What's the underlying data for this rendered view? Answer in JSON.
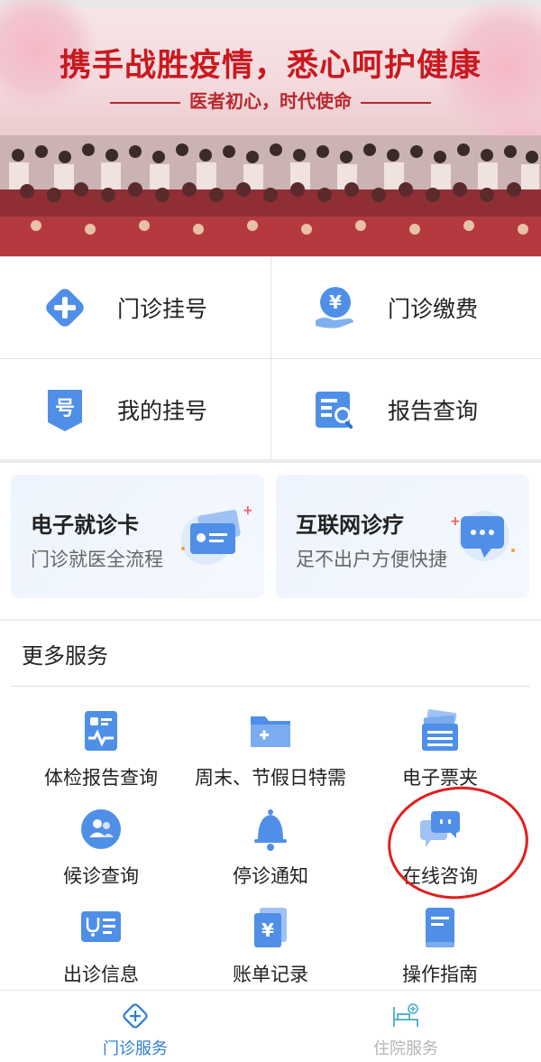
{
  "banner": {
    "headline": "携手战胜疫情，悉心呵护健康",
    "subline": "医者初心，时代使命"
  },
  "quick_actions": [
    {
      "label": "门诊挂号",
      "icon": "plus-diamond-icon"
    },
    {
      "label": "门诊缴费",
      "icon": "yuan-hand-icon"
    },
    {
      "label": "我的挂号",
      "icon": "number-tag-icon"
    },
    {
      "label": "报告查询",
      "icon": "report-search-icon"
    }
  ],
  "cards": [
    {
      "title": "电子就诊卡",
      "subtitle": "门诊就医全流程",
      "icon": "medical-card-icon"
    },
    {
      "title": "互联网诊疗",
      "subtitle": "足不出户方便快捷",
      "icon": "chat-bubble-icon"
    }
  ],
  "more_services": {
    "title": "更多服务",
    "items": [
      {
        "label": "体检报告查询",
        "icon": "health-report-icon"
      },
      {
        "label": "周末、节假日特需",
        "icon": "folder-plus-icon"
      },
      {
        "label": "电子票夹",
        "icon": "ticket-folder-icon"
      },
      {
        "label": "候诊查询",
        "icon": "waiting-people-icon"
      },
      {
        "label": "停诊通知",
        "icon": "bell-icon"
      },
      {
        "label": "在线咨询",
        "icon": "consult-chat-icon"
      },
      {
        "label": "出诊信息",
        "icon": "doctor-schedule-icon"
      },
      {
        "label": "账单记录",
        "icon": "bill-yuan-icon"
      },
      {
        "label": "操作指南",
        "icon": "guide-book-icon"
      }
    ]
  },
  "tabbar": {
    "items": [
      {
        "label": "门诊服务",
        "active": true
      },
      {
        "label": "住院服务",
        "active": false
      }
    ]
  },
  "colors": {
    "accent": "#2f7dd6",
    "icon_blue": "#4f8fe8",
    "annotation_red": "#e21e1e",
    "inactive_tab": "#b5b5b5"
  }
}
